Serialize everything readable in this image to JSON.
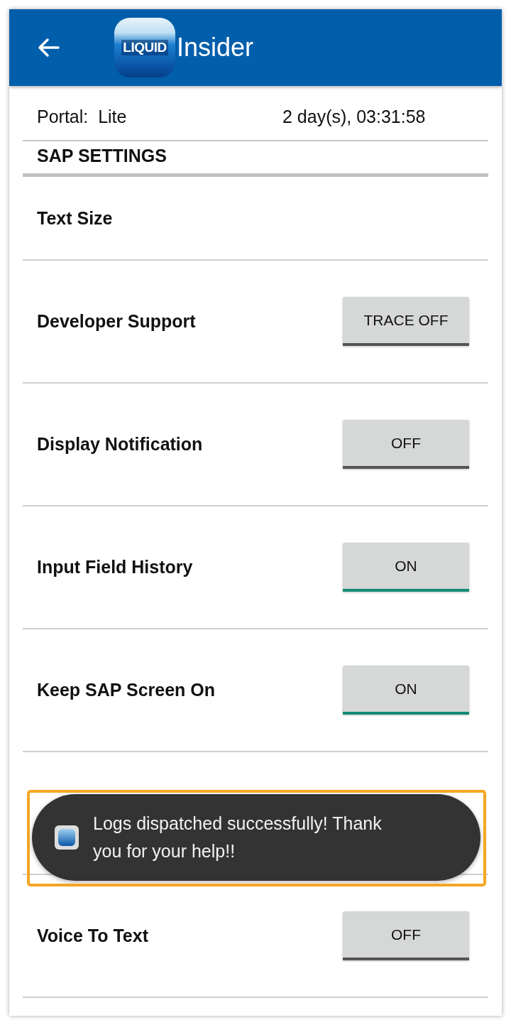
{
  "header": {
    "logo_text": "LIQUID",
    "title": "Insider"
  },
  "license": [
    {
      "label": "Portal:  Lite",
      "value": "2 day(s), 03:31:58"
    }
  ],
  "section_title": "SAP SETTINGS",
  "settings": [
    {
      "kind": "plain",
      "label": "Text Size"
    },
    {
      "kind": "toggle",
      "label": "Developer Support",
      "button": "TRACE OFF",
      "on": false
    },
    {
      "kind": "toggle",
      "label": "Display Notification",
      "button": "OFF",
      "on": false
    },
    {
      "kind": "toggle",
      "label": "Input Field History",
      "button": "ON",
      "on": true
    },
    {
      "kind": "toggle",
      "label": "Keep SAP Screen On",
      "button": "ON",
      "on": true
    },
    {
      "kind": "hidden"
    },
    {
      "kind": "toggle",
      "label": "Voice To Text",
      "button": "OFF",
      "on": false
    }
  ],
  "toast": {
    "message": "Logs dispatched successfully! Thank you for your help!!",
    "highlighted": true
  }
}
